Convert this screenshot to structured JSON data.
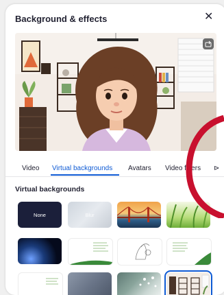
{
  "dialog": {
    "title": "Background & effects",
    "close_glyph": "✕"
  },
  "tabs": [
    {
      "label": "Video",
      "active": false
    },
    {
      "label": "Virtual backgrounds",
      "active": true
    },
    {
      "label": "Avatars",
      "active": false
    },
    {
      "label": "Video filters",
      "active": false
    }
  ],
  "more_tabs_glyph": "⊳",
  "section": {
    "title": "Virtual backgrounds"
  },
  "backgrounds": [
    {
      "label": "None",
      "selected": false
    },
    {
      "label": "Blur",
      "selected": false
    },
    {
      "label": "",
      "selected": false
    },
    {
      "label": "",
      "selected": false
    },
    {
      "label": "",
      "selected": false
    },
    {
      "label": "",
      "selected": false
    },
    {
      "label": "",
      "selected": false
    },
    {
      "label": "",
      "selected": false
    },
    {
      "label": "",
      "selected": false
    },
    {
      "label": "",
      "selected": false
    },
    {
      "label": "",
      "selected": false
    },
    {
      "label": "",
      "selected": true
    }
  ],
  "colors": {
    "accent": "#0e5ad4",
    "annotation": "#c8102e"
  }
}
